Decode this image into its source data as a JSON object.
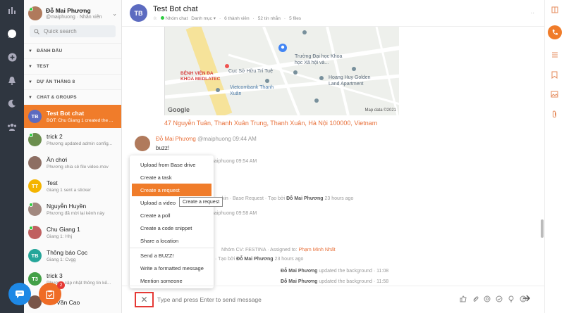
{
  "me": {
    "name": "Đỗ Mai Phương",
    "sub": "@maiphuong · Nhân viên"
  },
  "search": {
    "placeholder": "Quick search"
  },
  "sections": [
    "ĐÁNH DẤU",
    "TEST",
    "DỰ ÁN THÁNG 8",
    "CHAT & GROUPS"
  ],
  "conversations": [
    {
      "title": "Test Bot chat",
      "preview": "BOT: Chu Giang 1 created the ...",
      "initials": "TB",
      "color": "#5c6bc0"
    },
    {
      "title": "trick 2",
      "preview": "Phương updated admin config...",
      "initials": "",
      "color": "#6b8e4e"
    },
    {
      "title": "Ăn chơi",
      "preview": "Phương chia sẻ file video.mov",
      "initials": "",
      "color": "#8d6e63"
    },
    {
      "title": "Test",
      "preview": "Giang 1 sent a sticker",
      "initials": "TT",
      "color": "#f4b400"
    },
    {
      "title": "Nguyễn Huyền",
      "preview": "Phương đã mời lại kênh này",
      "initials": "",
      "color": "#a1887f"
    },
    {
      "title": "Chu Giang 1",
      "preview": "Giang 1: Hhj",
      "initials": "",
      "color": "#c06060"
    },
    {
      "title": "Thông báo Cọc",
      "preview": "Giang 1: Cvgg",
      "initials": "TB",
      "color": "#26a69a"
    },
    {
      "title": "trick 3",
      "preview": "Phương cập nhật thông tin kế...",
      "initials": "T3",
      "color": "#43a047"
    },
    {
      "title": "...n Văn Cao",
      "preview": "",
      "initials": "",
      "color": "#795548"
    }
  ],
  "fab_badge": "2",
  "header": {
    "initials": "TB",
    "title": "Test Bot chat",
    "meta": [
      "Nhóm chat",
      "Danh mục",
      "6 thành viên",
      "52 tin nhắn",
      "5 files"
    ],
    "more": "··"
  },
  "map": {
    "labels": [
      "Trường Đại học Khoa học Xã hội và...",
      "Cục Sở Hữu Trí Tuệ",
      "BỆNH VIỆN ĐA KHOA MEDLATEC",
      "Vietcombank Thanh Xuân",
      "Hoang Huy Golden Land Apartment",
      "Google",
      "Map data ©2021"
    ]
  },
  "address": "47 Nguyễn Tuân, Thanh Xuân Trung, Thanh Xuân, Hà Nội 100000, Vietnam",
  "message": {
    "name": "Đỗ Mai Phương",
    "handle": "@maiphuong",
    "time": "09:44 AM",
    "body": "buzz!"
  },
  "background_lines": {
    "l1": "@maiphuong  09:54 AM",
    "l2a": "...kin · Base Request · Tạo bởi",
    "l2b": "Đỗ Mai Phương",
    "l2c": "23 hours ago",
    "l3": "@maiphuong  09:58 AM",
    "l4a": "Nhóm CV: FESTINA · Assigned to:",
    "l4b": "Phạm Minh Nhất",
    "l5a": "· Tạo bởi",
    "l5b": "Đỗ Mai Phương",
    "l5c": "23 hours ago",
    "l6a": "Đỗ Mai Phương",
    "l6b": "updated the background · 11:08",
    "l7a": "Đỗ Mai Phương",
    "l7b": "updated the background · 11:58"
  },
  "menu": {
    "items": [
      "Upload from Base drive",
      "Create a task",
      "Create a request",
      "Upload a video",
      "Create a poll",
      "Create a code snippet",
      "Share a location",
      "Send a BUZZ!",
      "Write a formatted message",
      "Mention someone"
    ],
    "selected": 2
  },
  "tooltip": "Create a request",
  "composer": {
    "placeholder": "Type and press Enter to send message",
    "close": "✕"
  },
  "colors": {
    "accent": "#f07c2a",
    "rail": "#2f3640",
    "link": "#e8703a"
  }
}
